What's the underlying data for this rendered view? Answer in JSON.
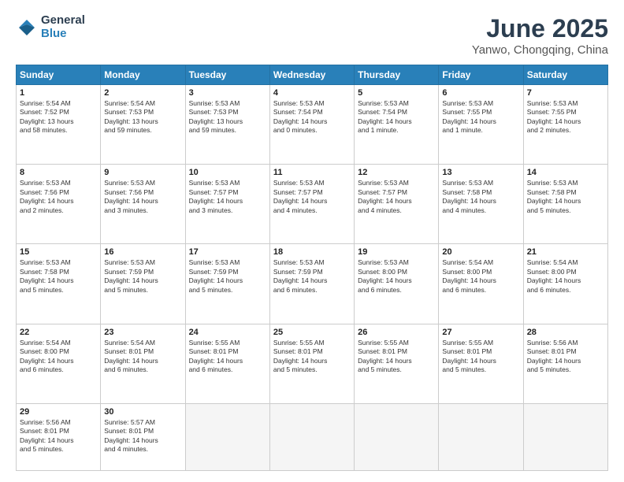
{
  "header": {
    "logo_general": "General",
    "logo_blue": "Blue",
    "main_title": "June 2025",
    "subtitle": "Yanwo, Chongqing, China"
  },
  "days_of_week": [
    "Sunday",
    "Monday",
    "Tuesday",
    "Wednesday",
    "Thursday",
    "Friday",
    "Saturday"
  ],
  "weeks": [
    [
      {
        "day": "1",
        "sunrise": "5:54 AM",
        "sunset": "7:52 PM",
        "daylight": "13 hours and 58 minutes."
      },
      {
        "day": "2",
        "sunrise": "5:54 AM",
        "sunset": "7:53 PM",
        "daylight": "13 hours and 59 minutes."
      },
      {
        "day": "3",
        "sunrise": "5:53 AM",
        "sunset": "7:53 PM",
        "daylight": "13 hours and 59 minutes."
      },
      {
        "day": "4",
        "sunrise": "5:53 AM",
        "sunset": "7:54 PM",
        "daylight": "14 hours and 0 minutes."
      },
      {
        "day": "5",
        "sunrise": "5:53 AM",
        "sunset": "7:54 PM",
        "daylight": "14 hours and 1 minute."
      },
      {
        "day": "6",
        "sunrise": "5:53 AM",
        "sunset": "7:55 PM",
        "daylight": "14 hours and 1 minute."
      },
      {
        "day": "7",
        "sunrise": "5:53 AM",
        "sunset": "7:55 PM",
        "daylight": "14 hours and 2 minutes."
      }
    ],
    [
      {
        "day": "8",
        "sunrise": "5:53 AM",
        "sunset": "7:56 PM",
        "daylight": "14 hours and 2 minutes."
      },
      {
        "day": "9",
        "sunrise": "5:53 AM",
        "sunset": "7:56 PM",
        "daylight": "14 hours and 3 minutes."
      },
      {
        "day": "10",
        "sunrise": "5:53 AM",
        "sunset": "7:57 PM",
        "daylight": "14 hours and 3 minutes."
      },
      {
        "day": "11",
        "sunrise": "5:53 AM",
        "sunset": "7:57 PM",
        "daylight": "14 hours and 4 minutes."
      },
      {
        "day": "12",
        "sunrise": "5:53 AM",
        "sunset": "7:57 PM",
        "daylight": "14 hours and 4 minutes."
      },
      {
        "day": "13",
        "sunrise": "5:53 AM",
        "sunset": "7:58 PM",
        "daylight": "14 hours and 4 minutes."
      },
      {
        "day": "14",
        "sunrise": "5:53 AM",
        "sunset": "7:58 PM",
        "daylight": "14 hours and 5 minutes."
      }
    ],
    [
      {
        "day": "15",
        "sunrise": "5:53 AM",
        "sunset": "7:58 PM",
        "daylight": "14 hours and 5 minutes."
      },
      {
        "day": "16",
        "sunrise": "5:53 AM",
        "sunset": "7:59 PM",
        "daylight": "14 hours and 5 minutes."
      },
      {
        "day": "17",
        "sunrise": "5:53 AM",
        "sunset": "7:59 PM",
        "daylight": "14 hours and 5 minutes."
      },
      {
        "day": "18",
        "sunrise": "5:53 AM",
        "sunset": "7:59 PM",
        "daylight": "14 hours and 6 minutes."
      },
      {
        "day": "19",
        "sunrise": "5:53 AM",
        "sunset": "8:00 PM",
        "daylight": "14 hours and 6 minutes."
      },
      {
        "day": "20",
        "sunrise": "5:54 AM",
        "sunset": "8:00 PM",
        "daylight": "14 hours and 6 minutes."
      },
      {
        "day": "21",
        "sunrise": "5:54 AM",
        "sunset": "8:00 PM",
        "daylight": "14 hours and 6 minutes."
      }
    ],
    [
      {
        "day": "22",
        "sunrise": "5:54 AM",
        "sunset": "8:00 PM",
        "daylight": "14 hours and 6 minutes."
      },
      {
        "day": "23",
        "sunrise": "5:54 AM",
        "sunset": "8:01 PM",
        "daylight": "14 hours and 6 minutes."
      },
      {
        "day": "24",
        "sunrise": "5:55 AM",
        "sunset": "8:01 PM",
        "daylight": "14 hours and 6 minutes."
      },
      {
        "day": "25",
        "sunrise": "5:55 AM",
        "sunset": "8:01 PM",
        "daylight": "14 hours and 5 minutes."
      },
      {
        "day": "26",
        "sunrise": "5:55 AM",
        "sunset": "8:01 PM",
        "daylight": "14 hours and 5 minutes."
      },
      {
        "day": "27",
        "sunrise": "5:55 AM",
        "sunset": "8:01 PM",
        "daylight": "14 hours and 5 minutes."
      },
      {
        "day": "28",
        "sunrise": "5:56 AM",
        "sunset": "8:01 PM",
        "daylight": "14 hours and 5 minutes."
      }
    ],
    [
      {
        "day": "29",
        "sunrise": "5:56 AM",
        "sunset": "8:01 PM",
        "daylight": "14 hours and 5 minutes."
      },
      {
        "day": "30",
        "sunrise": "5:57 AM",
        "sunset": "8:01 PM",
        "daylight": "14 hours and 4 minutes."
      },
      null,
      null,
      null,
      null,
      null
    ]
  ]
}
